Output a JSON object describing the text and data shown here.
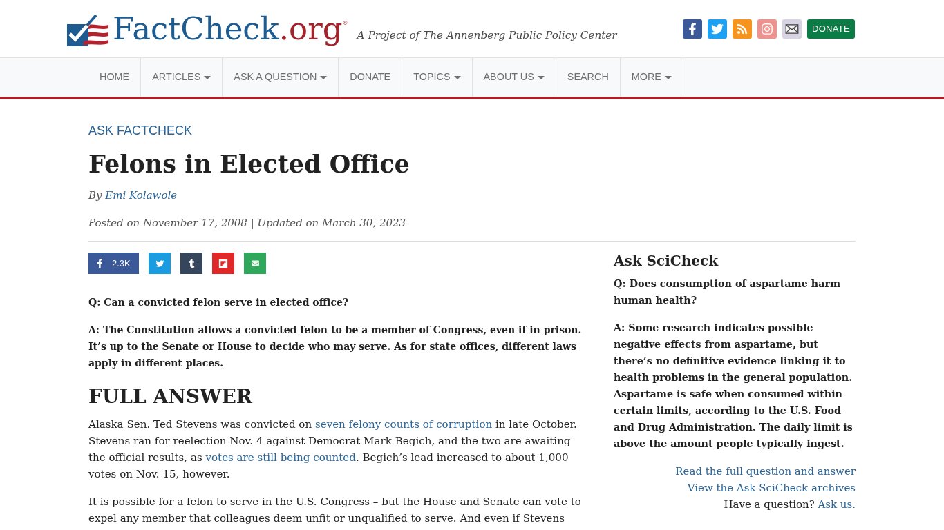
{
  "header": {
    "logo": {
      "name": "FactCheck",
      "domain": ".org",
      "mark": "®"
    },
    "tagline": "A Project of The Annenberg Public Policy Center",
    "donate_button": "DONATE"
  },
  "nav": {
    "items": [
      {
        "label": "HOME",
        "has_menu": false
      },
      {
        "label": "ARTICLES",
        "has_menu": true
      },
      {
        "label": "ASK A QUESTION",
        "has_menu": true
      },
      {
        "label": "DONATE",
        "has_menu": false
      },
      {
        "label": "TOPICS",
        "has_menu": true
      },
      {
        "label": "ABOUT US",
        "has_menu": true
      },
      {
        "label": "SEARCH",
        "has_menu": false
      },
      {
        "label": "MORE",
        "has_menu": true
      }
    ]
  },
  "article": {
    "category": "ASK FACTCHECK",
    "title": "Felons in Elected Office",
    "byline": {
      "prefix": "By",
      "author": "Emi Kolawole"
    },
    "dates": "Posted on November 17, 2008 | Updated on March 30, 2023",
    "share": {
      "count": "2.3K"
    },
    "question": "Q: Can a convicted felon serve in elected office?",
    "answer": "A: The Constitution allows a convicted felon to be a member of Congress, even if in prison. It’s up to the Senate or House to decide who may serve. As for state offices, different laws apply in different places.",
    "section_heading": "FULL ANSWER",
    "paragraphs": [
      [
        {
          "kind": "text",
          "text": "Alaska Sen. Ted Stevens was convicted on "
        },
        {
          "kind": "link",
          "text": "seven felony counts of corruption"
        },
        {
          "kind": "text",
          "text": " in late October. Stevens ran for reelection Nov. 4 against Democrat Mark Begich, and the two are awaiting the official results, as "
        },
        {
          "kind": "link",
          "text": "votes are still being counted"
        },
        {
          "kind": "text",
          "text": ". Begich’s lead increased to about 1,000 votes on Nov. 15, however."
        }
      ],
      [
        {
          "kind": "text",
          "text": "It is possible for a felon to serve in the U.S. Congress – but the House and Senate can vote to expel any member that colleagues deem unfit or unqualified to serve. And even if Stevens"
        }
      ]
    ]
  },
  "sidebar": {
    "title": "Ask SciCheck",
    "question": "Q: Does consumption of aspartame harm human health?",
    "answer": "A: Some research indicates possible negative effects from aspartame, but there’s no definitive evidence linking it to health problems in the general population. Aspartame is safe when consumed within certain limits, according to the U.S. Food and Drug Administration. The daily limit is above the amount people typically ingest.",
    "links": [
      "Read the full question and answer",
      "View the Ask SciCheck archives"
    ],
    "prompt": [
      {
        "kind": "text",
        "text": "Have a question? "
      },
      {
        "kind": "link",
        "text": "Ask us."
      }
    ]
  }
}
